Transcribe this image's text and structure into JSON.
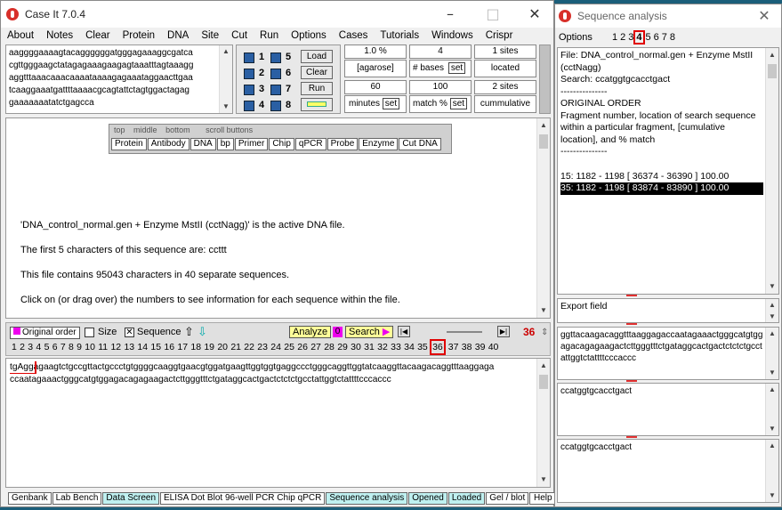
{
  "left": {
    "title": "Case It 7.0.4",
    "menu": [
      "About",
      "Notes",
      "Clear",
      "Protein",
      "DNA",
      "Site",
      "Cut",
      "Run",
      "Options",
      "Cases",
      "Tutorials",
      "Windows",
      "Crispr"
    ],
    "seq_preview": [
      "aaggggaaaagtacaggggggatgggagaaaggcgatca",
      "cgttgggaagctatagagaaagaagagtaaatttagtaaagg",
      "aggtttaaacaaacaaaataaaagagaaataggaacttgaa",
      "tcaaggaaatgattttaaaacgcagtattctagtggactagag",
      "gaaaaaaatatctgagcca"
    ],
    "lanes": [
      "1",
      "2",
      "3",
      "4",
      "5",
      "6",
      "7",
      "8"
    ],
    "load_label": "Load",
    "clear_label": "Clear",
    "run_label": "Run",
    "agarose_val": "1.0  %",
    "agarose_label": "[agarose]",
    "bases_val": "4",
    "bases_label": "# bases",
    "set": "set",
    "sites_val": "1  sites",
    "sites_label": "located",
    "minutes_val": "60",
    "minutes_label": "minutes",
    "match_val": "100",
    "match_label": "match %",
    "sites2_val": "2  sites",
    "cum_label": "cummulative",
    "tabs_row1": [
      "top",
      "middle",
      "bottom",
      "scroll buttons"
    ],
    "tabs_row2": [
      "Protein",
      "Antibody",
      "DNA",
      "bp",
      "Primer",
      "Chip",
      "qPCR",
      "Probe",
      "Enzyme",
      "Cut DNA"
    ],
    "lines": [
      "'DNA_control_normal.gen + Enzyme MstII (cctNagg)' is the active DNA file.",
      "The first 5 characters of this sequence are:  ccttt",
      "This file contains 95043 characters in 40 separate sequences.",
      "Click on (or drag over) the numbers to see information for each sequence within the file."
    ],
    "order_label": "Original order",
    "size_label": "Size",
    "seq_label": "Sequence",
    "analyze_label": "Analyze",
    "zero_label": "0",
    "search_label": "Search",
    "current": "36",
    "seq_numbers": [
      "1",
      "2",
      "3",
      "4",
      "5",
      "6",
      "7",
      "8",
      "9",
      "10",
      "11",
      "12",
      "13",
      "14",
      "15",
      "16",
      "17",
      "18",
      "19",
      "20",
      "21",
      "22",
      "23",
      "24",
      "25",
      "26",
      "27",
      "28",
      "29",
      "30",
      "31",
      "32",
      "33",
      "34",
      "35",
      "36",
      "37",
      "38",
      "39",
      "40"
    ],
    "dna_hl": "tgAgg",
    "dna_line1": "agaagtctgccgttactgccctgtggggcaaggtgaacgtggatgaagttggtggtgaggccctgggcaggttggtatcaaggttacaagacaggtttaaggaga",
    "dna_line2": "ccaatagaaactgggcatgtggagacagagaagactcttgggtttctgataggcactgactctctctgcctattggtctattttcccaccc",
    "bottom_tabs": [
      "Genbank",
      "Lab Bench",
      "Data Screen",
      "ELISA  Dot Blot  96-well PCR  Chip  qPCR",
      "Sequence analysis",
      "Opened",
      "Loaded",
      "Gel / blot",
      "Help"
    ]
  },
  "right": {
    "title": "Sequence analysis",
    "options_label": "Options",
    "opt_nums": [
      "1",
      "2",
      "3",
      "4",
      "5",
      "6",
      "7",
      "8"
    ],
    "info": [
      "File:  DNA_control_normal.gen + Enzyme MstII",
      "(cctNagg)",
      "Search:  ccatggtgcacctgact",
      "---------------",
      "ORIGINAL ORDER",
      "Fragment number, location of search sequence",
      "within a particular fragment, [cumulative",
      "location], and % match",
      "---------------"
    ],
    "result1": "15: 1182 - 1198 [ 36374 - 36390 ]  100.00",
    "result2": "35: 1182 - 1198 [ 83874 - 83890 ]  100.00",
    "export_label": "Export field",
    "export_text": "ggttacaagacaggtttaaggagaccaatagaaactgggcatgtggagacagagaagactcttgggtttctgataggcactgactctctctgcctattggtctattttcccaccc",
    "field2": "ccatggtgcacctgact",
    "field3": "ccatggtgcacctgact"
  }
}
